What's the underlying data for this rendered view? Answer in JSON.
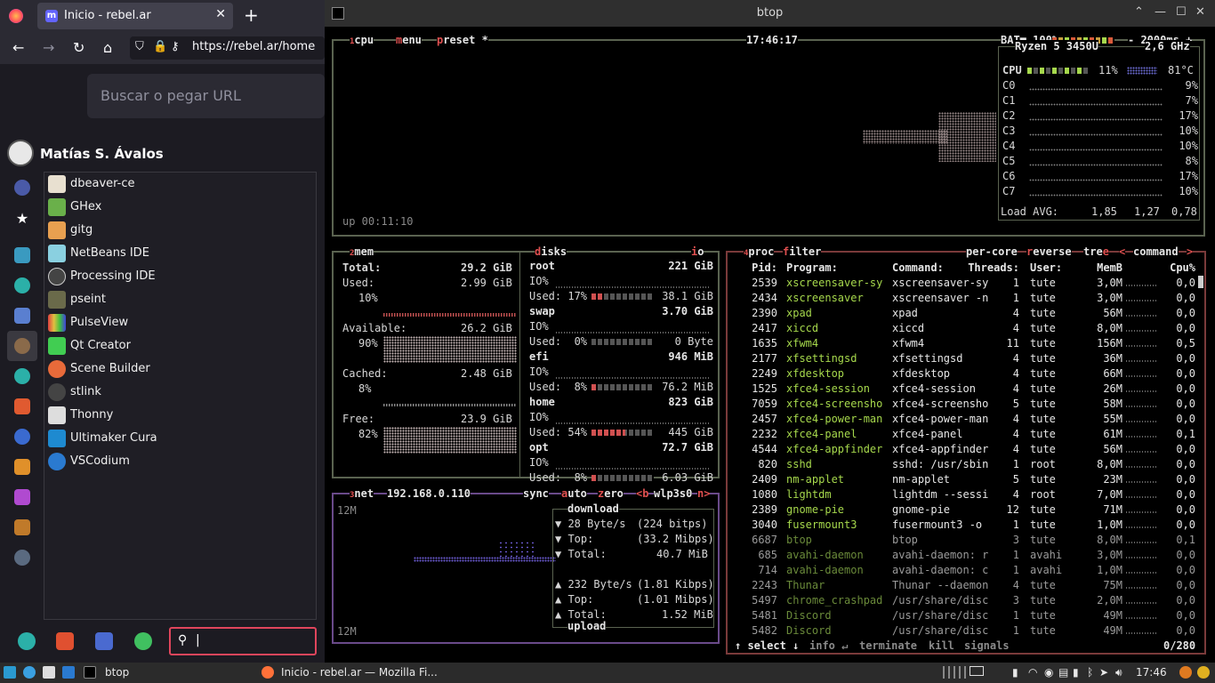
{
  "firefox": {
    "tab_title": "Inicio - rebel.ar",
    "tab_favicon_letter": "m",
    "url": "https://rebel.ar/home",
    "search_placeholder": "Buscar o pegar URL",
    "user_name": "Matías S. Ávalos",
    "apps": [
      "dbeaver-ce",
      "GHex",
      "gitg",
      "NetBeans IDE",
      "Processing IDE",
      "pseint",
      "PulseView",
      "Qt Creator",
      "Scene Builder",
      "stlink",
      "Thonny",
      "Ultimaker Cura",
      "VSCodium"
    ],
    "search_value": "|"
  },
  "btop": {
    "window_title": "btop",
    "cpu": {
      "tab_num": "1",
      "tab_label": "cpu",
      "menu_key": "m",
      "menu_label": "enu",
      "preset_key": "p",
      "preset_label": "reset *",
      "clock": "17:46:17",
      "battery": "BAT■ 100%",
      "interval": "- 2000ms +",
      "model": "Ryzen 5 3450U",
      "freq": "2,6 GHz",
      "total_label": "CPU",
      "total_pct": "11%",
      "temp": "81°C",
      "cores": [
        {
          "name": "C0",
          "pct": "9%"
        },
        {
          "name": "C1",
          "pct": "7%"
        },
        {
          "name": "C2",
          "pct": "17%"
        },
        {
          "name": "C3",
          "pct": "10%"
        },
        {
          "name": "C4",
          "pct": "10%"
        },
        {
          "name": "C5",
          "pct": "8%"
        },
        {
          "name": "C6",
          "pct": "17%"
        },
        {
          "name": "C7",
          "pct": "10%"
        }
      ],
      "load_label": "Load AVG:",
      "load": [
        "1,85",
        "1,27",
        "0,78"
      ],
      "uptime": "up 00:11:10"
    },
    "mem": {
      "tab_num": "2",
      "tab_label": "mem",
      "total_label": "Total:",
      "total": "29.2 GiB",
      "used_label": "Used:",
      "used": "2.99 GiB",
      "used_pct": "10%",
      "avail_label": "Available:",
      "avail": "26.2 GiB",
      "avail_pct": "90%",
      "cached_label": "Cached:",
      "cached": "2.48 GiB",
      "cached_pct": "8%",
      "free_label": "Free:",
      "free": "23.9 GiB",
      "free_pct": "82%"
    },
    "disks": {
      "tab_key": "d",
      "tab_label": "isks",
      "io_key": "i",
      "io_label": "o",
      "items": [
        {
          "name": "root",
          "size": "221 GiB",
          "io": "IO%",
          "used_label": "Used: 17%",
          "used": "38.1 GiB"
        },
        {
          "name": "swap",
          "size": "3.70 GiB",
          "io": "IO%",
          "used_label": "Used:  0%",
          "used": "0 Byte"
        },
        {
          "name": "efi",
          "size": "946 MiB",
          "io": "IO%",
          "used_label": "Used:  8%",
          "used": "76.2 MiB"
        },
        {
          "name": "home",
          "size": "823 GiB",
          "io": "IO%",
          "used_label": "Used: 54%",
          "used": "445 GiB"
        },
        {
          "name": "opt",
          "size": "72.7 GiB",
          "io": "IO%",
          "used_label": "Used:  8%",
          "used": "6.03 GiB"
        }
      ]
    },
    "net": {
      "tab_num": "3",
      "tab_label": "net",
      "ip": "192.168.0.110",
      "sync": "sync",
      "auto_key": "a",
      "auto_label": "uto",
      "zero_key": "z",
      "zero_label": "ero",
      "prev_iface": "<b",
      "iface": "wlp3s0",
      "next_iface": "n>",
      "scale_top": "12M",
      "scale_bottom": "12M",
      "download_label": "download",
      "upload_label": "upload",
      "dl_rate": "▼ 28 Byte/s",
      "dl_rate_bits": "(224 bitps)",
      "dl_top": "▼ Top:",
      "dl_top_val": "(33.2 Mibps)",
      "dl_total": "▼ Total:",
      "dl_total_val": "40.7 MiB",
      "ul_rate": "▲ 232 Byte/s",
      "ul_rate_bits": "(1.81 Kibps)",
      "ul_top": "▲ Top:",
      "ul_top_val": "(1.01 Mibps)",
      "ul_total": "▲ Total:",
      "ul_total_val": "1.52 MiB"
    },
    "proc": {
      "tab_num": "4",
      "tab_label": "proc",
      "filter_key": "f",
      "filter_label": "ilter",
      "per_core": "per-core",
      "reverse_key": "r",
      "reverse_label": "everse",
      "tree_label": "tre",
      "tree_key": "e",
      "sort_prev": "<",
      "sort": "command",
      "sort_next": ">",
      "headers": [
        "Pid:",
        "Program:",
        "Command:",
        "Threads:",
        "User:",
        "MemB",
        "Cpu%"
      ],
      "rows": [
        [
          "2539",
          "xscreensaver-sy",
          "xscreensaver-sy",
          "1",
          "tute",
          "3,0M",
          "0,0"
        ],
        [
          "2434",
          "xscreensaver",
          "xscreensaver -n",
          "1",
          "tute",
          "3,0M",
          "0,0"
        ],
        [
          "2390",
          "xpad",
          "xpad",
          "4",
          "tute",
          "56M",
          "0,0"
        ],
        [
          "2417",
          "xiccd",
          "xiccd",
          "4",
          "tute",
          "8,0M",
          "0,0"
        ],
        [
          "1635",
          "xfwm4",
          "xfwm4",
          "11",
          "tute",
          "156M",
          "0,5"
        ],
        [
          "2177",
          "xfsettingsd",
          "xfsettingsd",
          "4",
          "tute",
          "36M",
          "0,0"
        ],
        [
          "2249",
          "xfdesktop",
          "xfdesktop",
          "4",
          "tute",
          "66M",
          "0,0"
        ],
        [
          "1525",
          "xfce4-session",
          "xfce4-session",
          "4",
          "tute",
          "26M",
          "0,0"
        ],
        [
          "7059",
          "xfce4-screensho",
          "xfce4-screensho",
          "5",
          "tute",
          "58M",
          "0,0"
        ],
        [
          "2457",
          "xfce4-power-man",
          "xfce4-power-man",
          "4",
          "tute",
          "55M",
          "0,0"
        ],
        [
          "2232",
          "xfce4-panel",
          "xfce4-panel",
          "4",
          "tute",
          "61M",
          "0,1"
        ],
        [
          "4544",
          "xfce4-appfinder",
          "xfce4-appfinder",
          "4",
          "tute",
          "56M",
          "0,0"
        ],
        [
          "820",
          "sshd",
          "sshd: /usr/sbin",
          "1",
          "root",
          "8,0M",
          "0,0"
        ],
        [
          "2409",
          "nm-applet",
          "nm-applet",
          "5",
          "tute",
          "23M",
          "0,0"
        ],
        [
          "1080",
          "lightdm",
          "lightdm --sessi",
          "4",
          "root",
          "7,0M",
          "0,0"
        ],
        [
          "2389",
          "gnome-pie",
          "gnome-pie",
          "12",
          "tute",
          "71M",
          "0,0"
        ],
        [
          "3040",
          "fusermount3",
          "fusermount3 -o",
          "1",
          "tute",
          "1,0M",
          "0,0"
        ],
        [
          "6687",
          "btop",
          "btop",
          "3",
          "tute",
          "8,0M",
          "0,1"
        ],
        [
          "685",
          "avahi-daemon",
          "avahi-daemon: r",
          "1",
          "avahi",
          "3,0M",
          "0,0"
        ],
        [
          "714",
          "avahi-daemon",
          "avahi-daemon: c",
          "1",
          "avahi",
          "1,0M",
          "0,0"
        ],
        [
          "2243",
          "Thunar",
          "Thunar --daemon",
          "4",
          "tute",
          "75M",
          "0,0"
        ],
        [
          "5497",
          "chrome_crashpad",
          "/usr/share/disc",
          "3",
          "tute",
          "2,0M",
          "0,0"
        ],
        [
          "5481",
          "Discord",
          "/usr/share/disc",
          "1",
          "tute",
          "49M",
          "0,0"
        ],
        [
          "5482",
          "Discord",
          "/usr/share/disc",
          "1",
          "tute",
          "49M",
          "0,0"
        ]
      ],
      "footer_select": "↑ select ↓",
      "footer_info": "info ↵",
      "footer_terminate": "terminate",
      "footer_kill": "kill",
      "footer_signals": "signals",
      "count": "0/280"
    }
  },
  "taskbar": {
    "btop_label": "btop",
    "ff_label": "Inicio - rebel.ar — Mozilla Fi...",
    "clock": "17:46"
  }
}
